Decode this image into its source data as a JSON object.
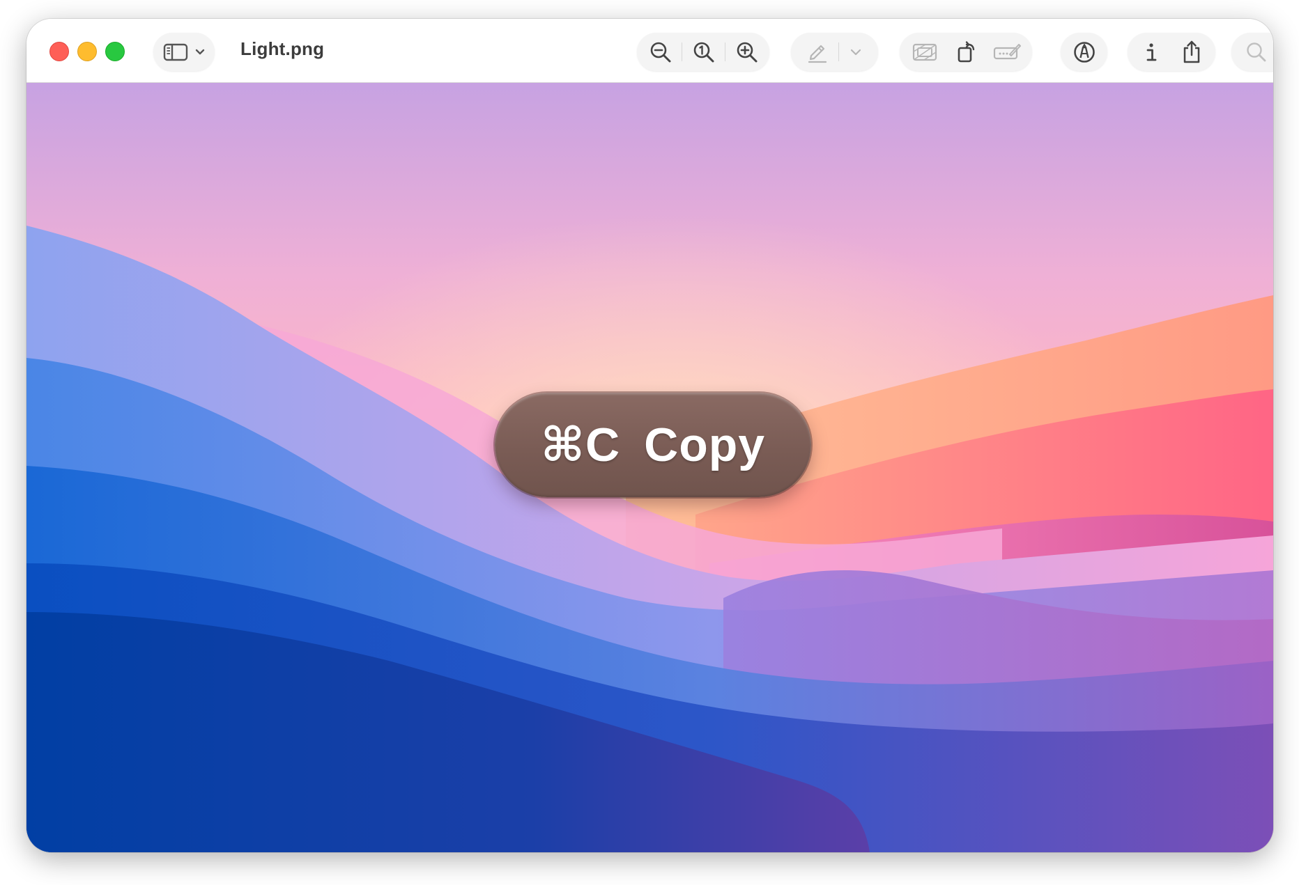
{
  "window": {
    "title": "Light.png"
  },
  "toolbar": {
    "icons": [
      "sidebar-icon",
      "chevron-down-icon",
      "zoom-out-icon",
      "actual-size-icon",
      "zoom-in-icon",
      "highlight-pen-icon",
      "chevron-down-icon",
      "crop-icon",
      "rotate-icon",
      "markup-signature-icon",
      "markup-icon",
      "info-icon",
      "share-icon",
      "search-icon"
    ]
  },
  "hud": {
    "shortcut": "⌘C",
    "action": "Copy"
  },
  "colors": {
    "close": "#fe5f57",
    "minimize": "#febc2e",
    "zoom": "#28c840",
    "hud_background": "#7a5c55"
  }
}
